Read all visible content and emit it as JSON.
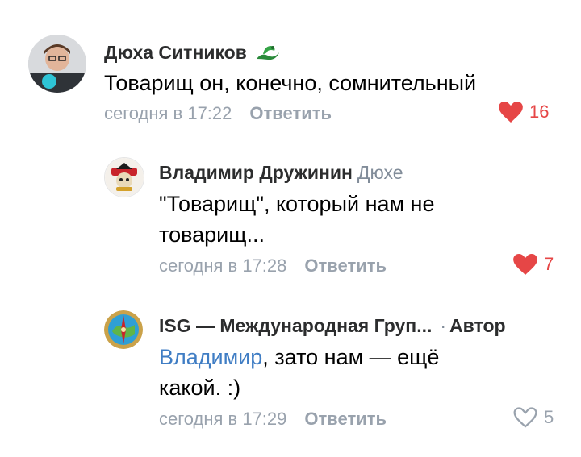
{
  "comments": [
    {
      "author": "Дюха Ситников",
      "text": "Товарищ он, конечно, сомнительный",
      "time": "сегодня в 17:22",
      "reply_label": "Ответить",
      "likes": "16",
      "liked": true
    },
    {
      "author": "Владимир Дружинин",
      "reply_to": "Дюхе",
      "text_line1": "\"Товарищ\", который нам не",
      "text_line2": "товарищ...",
      "time": "сегодня в 17:28",
      "reply_label": "Ответить",
      "likes": "7",
      "liked": true
    },
    {
      "author": "ISG — Международная Груп...",
      "author_tag": "Автор",
      "mention": "Владимир",
      "text_line1_rest": ", зато нам — ещё",
      "text_line2": "какой. :)",
      "time": "сегодня в 17:29",
      "reply_label": "Ответить",
      "likes": "5",
      "liked": false
    }
  ],
  "colors": {
    "like_active": "#e64646",
    "muted": "#99a2ad",
    "mention": "#3f7dc4"
  }
}
